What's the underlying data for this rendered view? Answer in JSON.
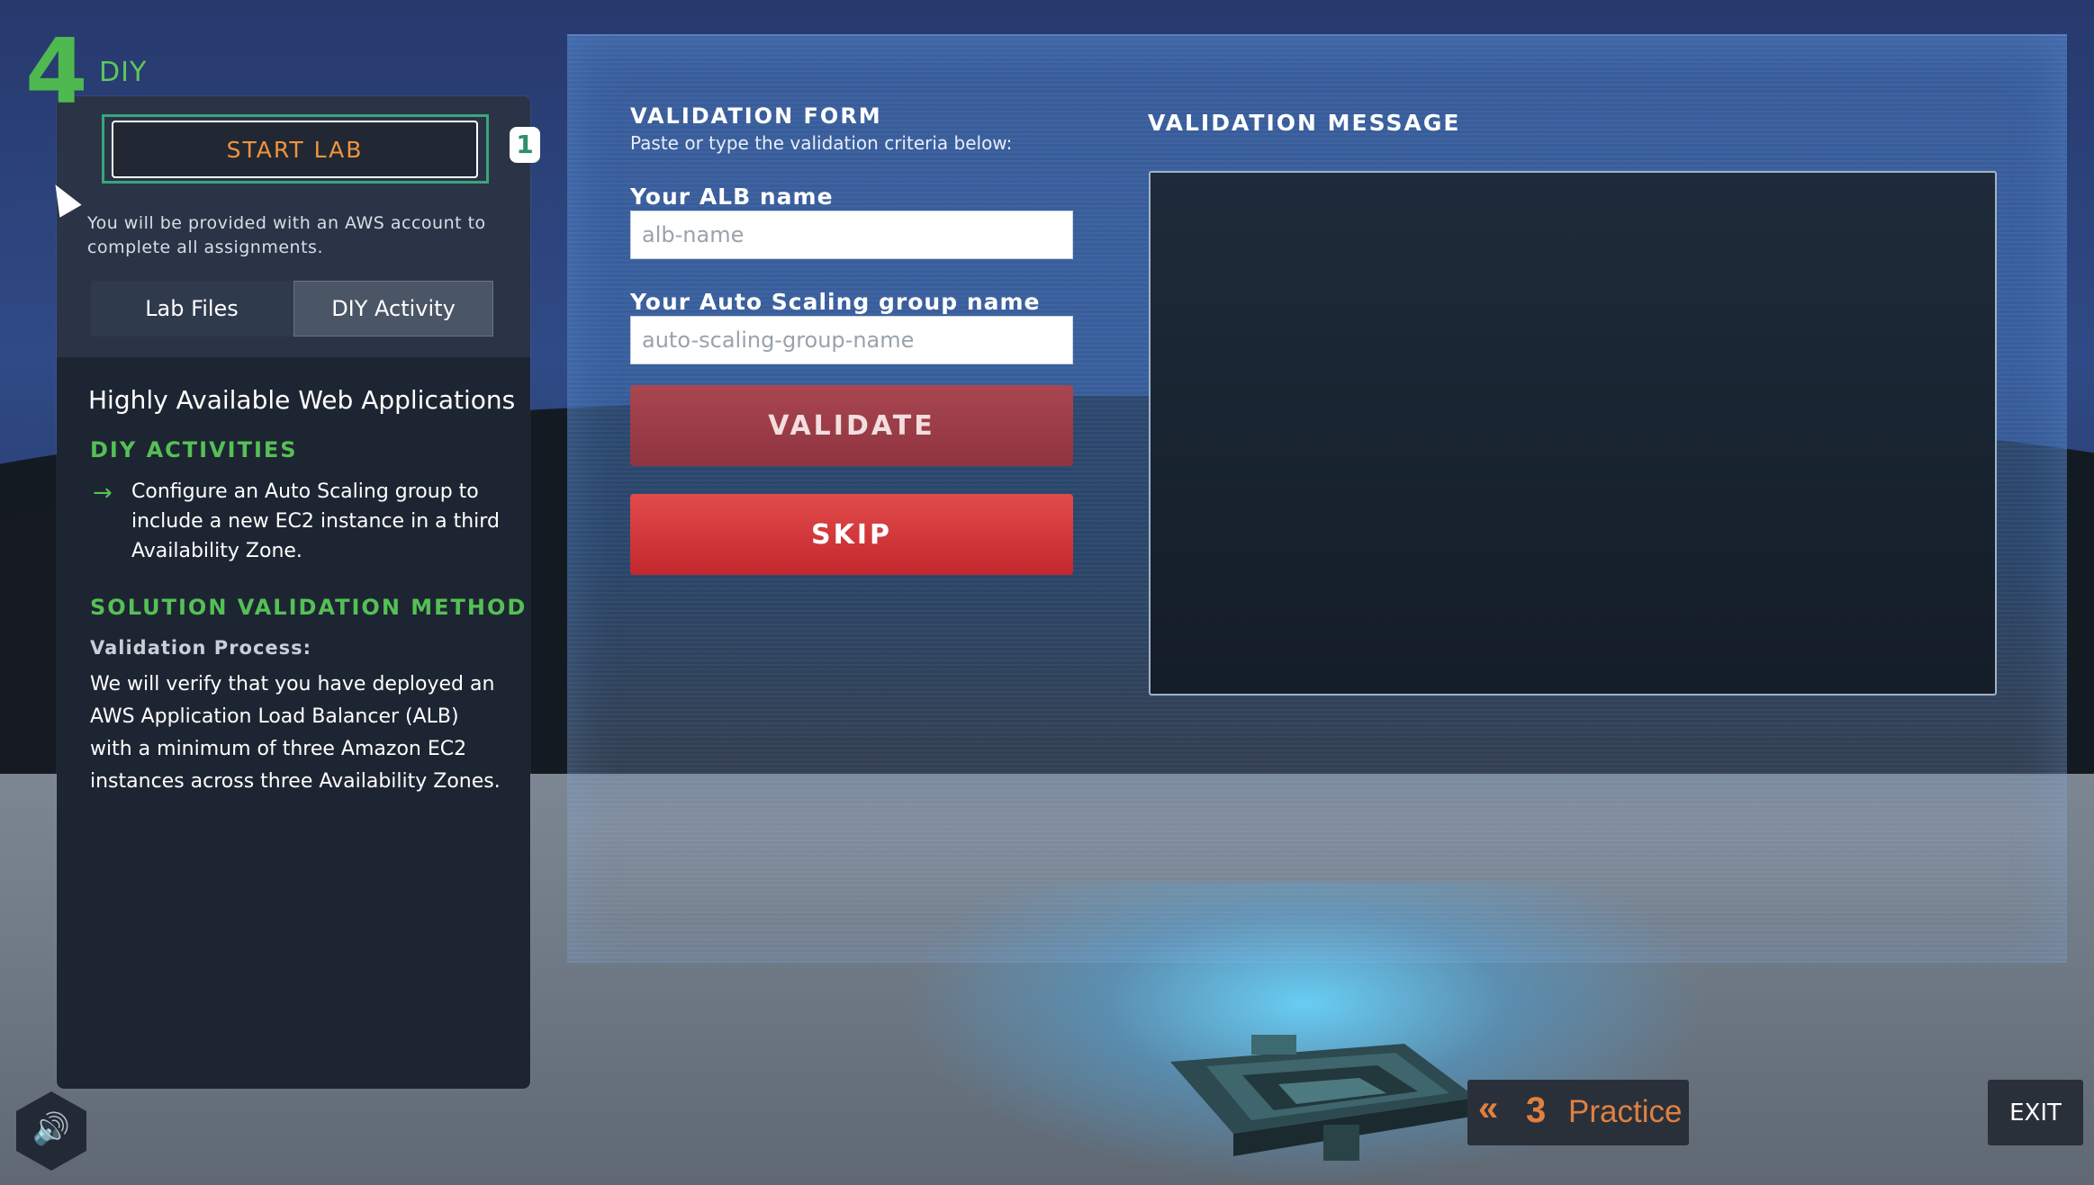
{
  "header": {
    "step_number": "4",
    "step_label": "DIY"
  },
  "left_panel": {
    "start_lab_label": "START LAB",
    "badge": "1",
    "note": "You will be provided with an AWS account to complete all assignments.",
    "tabs": [
      {
        "label": "Lab Files"
      },
      {
        "label": "DIY Activity"
      }
    ],
    "title": "Highly Available Web Applications",
    "activities_heading": "DIY ACTIVITIES",
    "activity_text": "Configure an Auto Scaling group to include a new EC2 instance in a third Availability Zone.",
    "solution_heading": "SOLUTION VALIDATION METHOD",
    "validation_process_label": "Validation Process:",
    "validation_text": "We will verify that you have deployed an AWS Application Load Balancer (ALB) with a minimum of three Amazon EC2 instances across three Availability Zones."
  },
  "form": {
    "title": "VALIDATION FORM",
    "subtitle": "Paste or type the validation criteria below:",
    "alb_label": "Your ALB name",
    "alb_placeholder": "alb-name",
    "asg_label": "Your Auto Scaling group name",
    "asg_placeholder": "auto-scaling-group-name",
    "validate_label": "VALIDATE",
    "skip_label": "SKIP"
  },
  "message": {
    "title": "VALIDATION MESSAGE"
  },
  "footer": {
    "practice_number": "3",
    "practice_label": "Practice",
    "exit_label": "EXIT"
  },
  "icons": {
    "speaker": "speaker-icon",
    "back": "double-chevron-left-icon",
    "arrow": "arrow-right-icon"
  },
  "colors": {
    "accent_green": "#55c055",
    "accent_orange": "#e08040",
    "skip_red": "#c2272d"
  }
}
